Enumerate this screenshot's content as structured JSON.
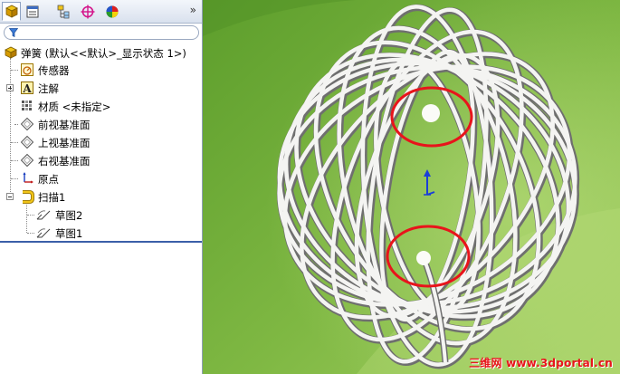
{
  "toolbar": {
    "tabs": [
      "feature-manager-tab",
      "property-manager-tab",
      "configuration-manager-tab",
      "dimxpert-manager-tab",
      "display-manager-tab"
    ],
    "more": "»"
  },
  "tree": {
    "root": "弹簧 (默认<<默认>_显示状态 1>)",
    "items": [
      {
        "label": "传感器"
      },
      {
        "label": "注解"
      },
      {
        "label": "材质 <未指定>"
      },
      {
        "label": "前视基准面"
      },
      {
        "label": "上视基准面"
      },
      {
        "label": "右视基准面"
      },
      {
        "label": "原点"
      },
      {
        "label": "扫描1"
      },
      {
        "label": "草图2"
      },
      {
        "label": "草图1"
      }
    ]
  },
  "viewport": {
    "background_colors": [
      "#5d9e2c",
      "#a3cf62"
    ],
    "highlight_color": "#e8141b",
    "watermark": "三维网 www.3dportal.cn"
  }
}
